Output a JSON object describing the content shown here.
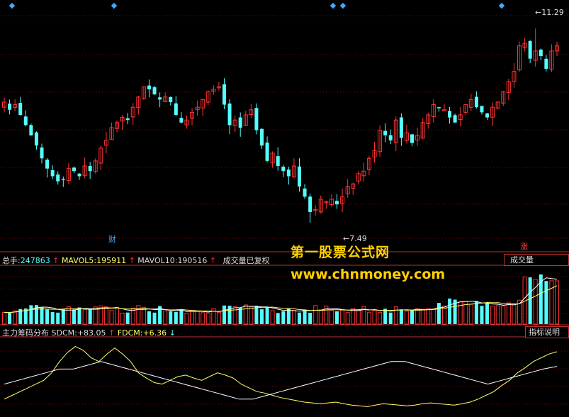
{
  "header_markers": [
    "◆",
    "◆",
    "◆",
    "◆",
    "◆"
  ],
  "price_panel": {
    "high_label": "11.29",
    "low_label": "7.49",
    "event_badge_cai": "财",
    "event_badge_zhang": "涨"
  },
  "volume_panel": {
    "total_label": "总手:",
    "total_value": "247863",
    "mavol5_label": "MAVOL5:",
    "mavol5_value": "195911",
    "mavol10_label": "MAVOL10:",
    "mavol10_value": "190516",
    "note": "成交量已复权",
    "selector": "成交量"
  },
  "indicator_panel": {
    "name": "主力筹码分布",
    "sdcm_label": "SDCM:",
    "sdcm_value": "+83.05",
    "fdcm_label": "FDCM:",
    "fdcm_value": "+6.36",
    "help_button": "指标说明"
  },
  "watermark": {
    "line1": "第一股票公式网",
    "line2": "www.chnmoney.com"
  },
  "colors": {
    "up": "#ff3333",
    "down": "#54ffff",
    "grid": "#8b0000",
    "mavol5": "#ffffff",
    "mavol10": "#ffff66",
    "sdcm": "#ffff66",
    "fdcm": "#ffffff",
    "watermark": "#ffd000"
  },
  "chart_data": [
    {
      "type": "candlestick",
      "y_range": [
        7.2,
        11.5
      ],
      "high": 11.29,
      "low": 7.49,
      "close": [
        9.85,
        9.7,
        9.8,
        9.6,
        9.4,
        9.2,
        9.0,
        8.75,
        8.55,
        8.4,
        8.3,
        8.35,
        8.55,
        8.5,
        8.4,
        8.6,
        8.5,
        8.7,
        8.95,
        9.1,
        9.35,
        9.45,
        9.55,
        9.5,
        9.75,
        9.95,
        10.15,
        10.1,
        10.0,
        9.9,
        9.95,
        9.85,
        9.6,
        9.45,
        9.5,
        9.65,
        9.75,
        9.9,
        10.05,
        10.1,
        10.15,
        9.8,
        9.4,
        9.5,
        9.35,
        9.6,
        9.7,
        9.3,
        9.0,
        8.7,
        8.85,
        8.6,
        8.5,
        8.4,
        8.6,
        8.2,
        8.0,
        7.7,
        7.75,
        7.95,
        7.9,
        7.95,
        7.85,
        8.0,
        8.2,
        8.25,
        8.45,
        8.5,
        8.75,
        8.9,
        9.3,
        9.2,
        9.1,
        9.5,
        9.15,
        9.25,
        9.05,
        9.2,
        9.45,
        9.6,
        9.8,
        9.75,
        9.7,
        9.55,
        9.45,
        9.6,
        9.8,
        9.9,
        9.75,
        9.65,
        9.55,
        9.75,
        9.85,
        10.05,
        10.25,
        10.45,
        10.95,
        11.0,
        10.7,
        10.85,
        10.75,
        10.5,
        10.85,
        10.95
      ],
      "volume_range": [
        0,
        260000
      ]
    },
    {
      "type": "line",
      "series": [
        {
          "name": "SDCM",
          "values": [
            20,
            25,
            30,
            35,
            40,
            45,
            55,
            70,
            82,
            90,
            85,
            75,
            70,
            80,
            88,
            80,
            70,
            55,
            48,
            42,
            40,
            45,
            50,
            52,
            48,
            45,
            50,
            55,
            52,
            48,
            40,
            35,
            30,
            28,
            25,
            22,
            20,
            18,
            16,
            15,
            14,
            15,
            16,
            14,
            12,
            11,
            10,
            12,
            14,
            13,
            12,
            11,
            12,
            14,
            15,
            14,
            13,
            12,
            14,
            16,
            20,
            25,
            30,
            38,
            45,
            55,
            62,
            70,
            75,
            80,
            83
          ]
        },
        {
          "name": "FDCM",
          "values": [
            4,
            4.5,
            5,
            5.5,
            6,
            6,
            6.5,
            7,
            6.5,
            6,
            5.5,
            5,
            4.5,
            4,
            3.5,
            3,
            2.5,
            2,
            2,
            2.5,
            3,
            3.5,
            4,
            4.5,
            5,
            5.5,
            6,
            6.5,
            7,
            7,
            6.5,
            6,
            5.5,
            5,
            4.5,
            4,
            4.5,
            5,
            5.5,
            6,
            6.36
          ]
        }
      ]
    }
  ]
}
